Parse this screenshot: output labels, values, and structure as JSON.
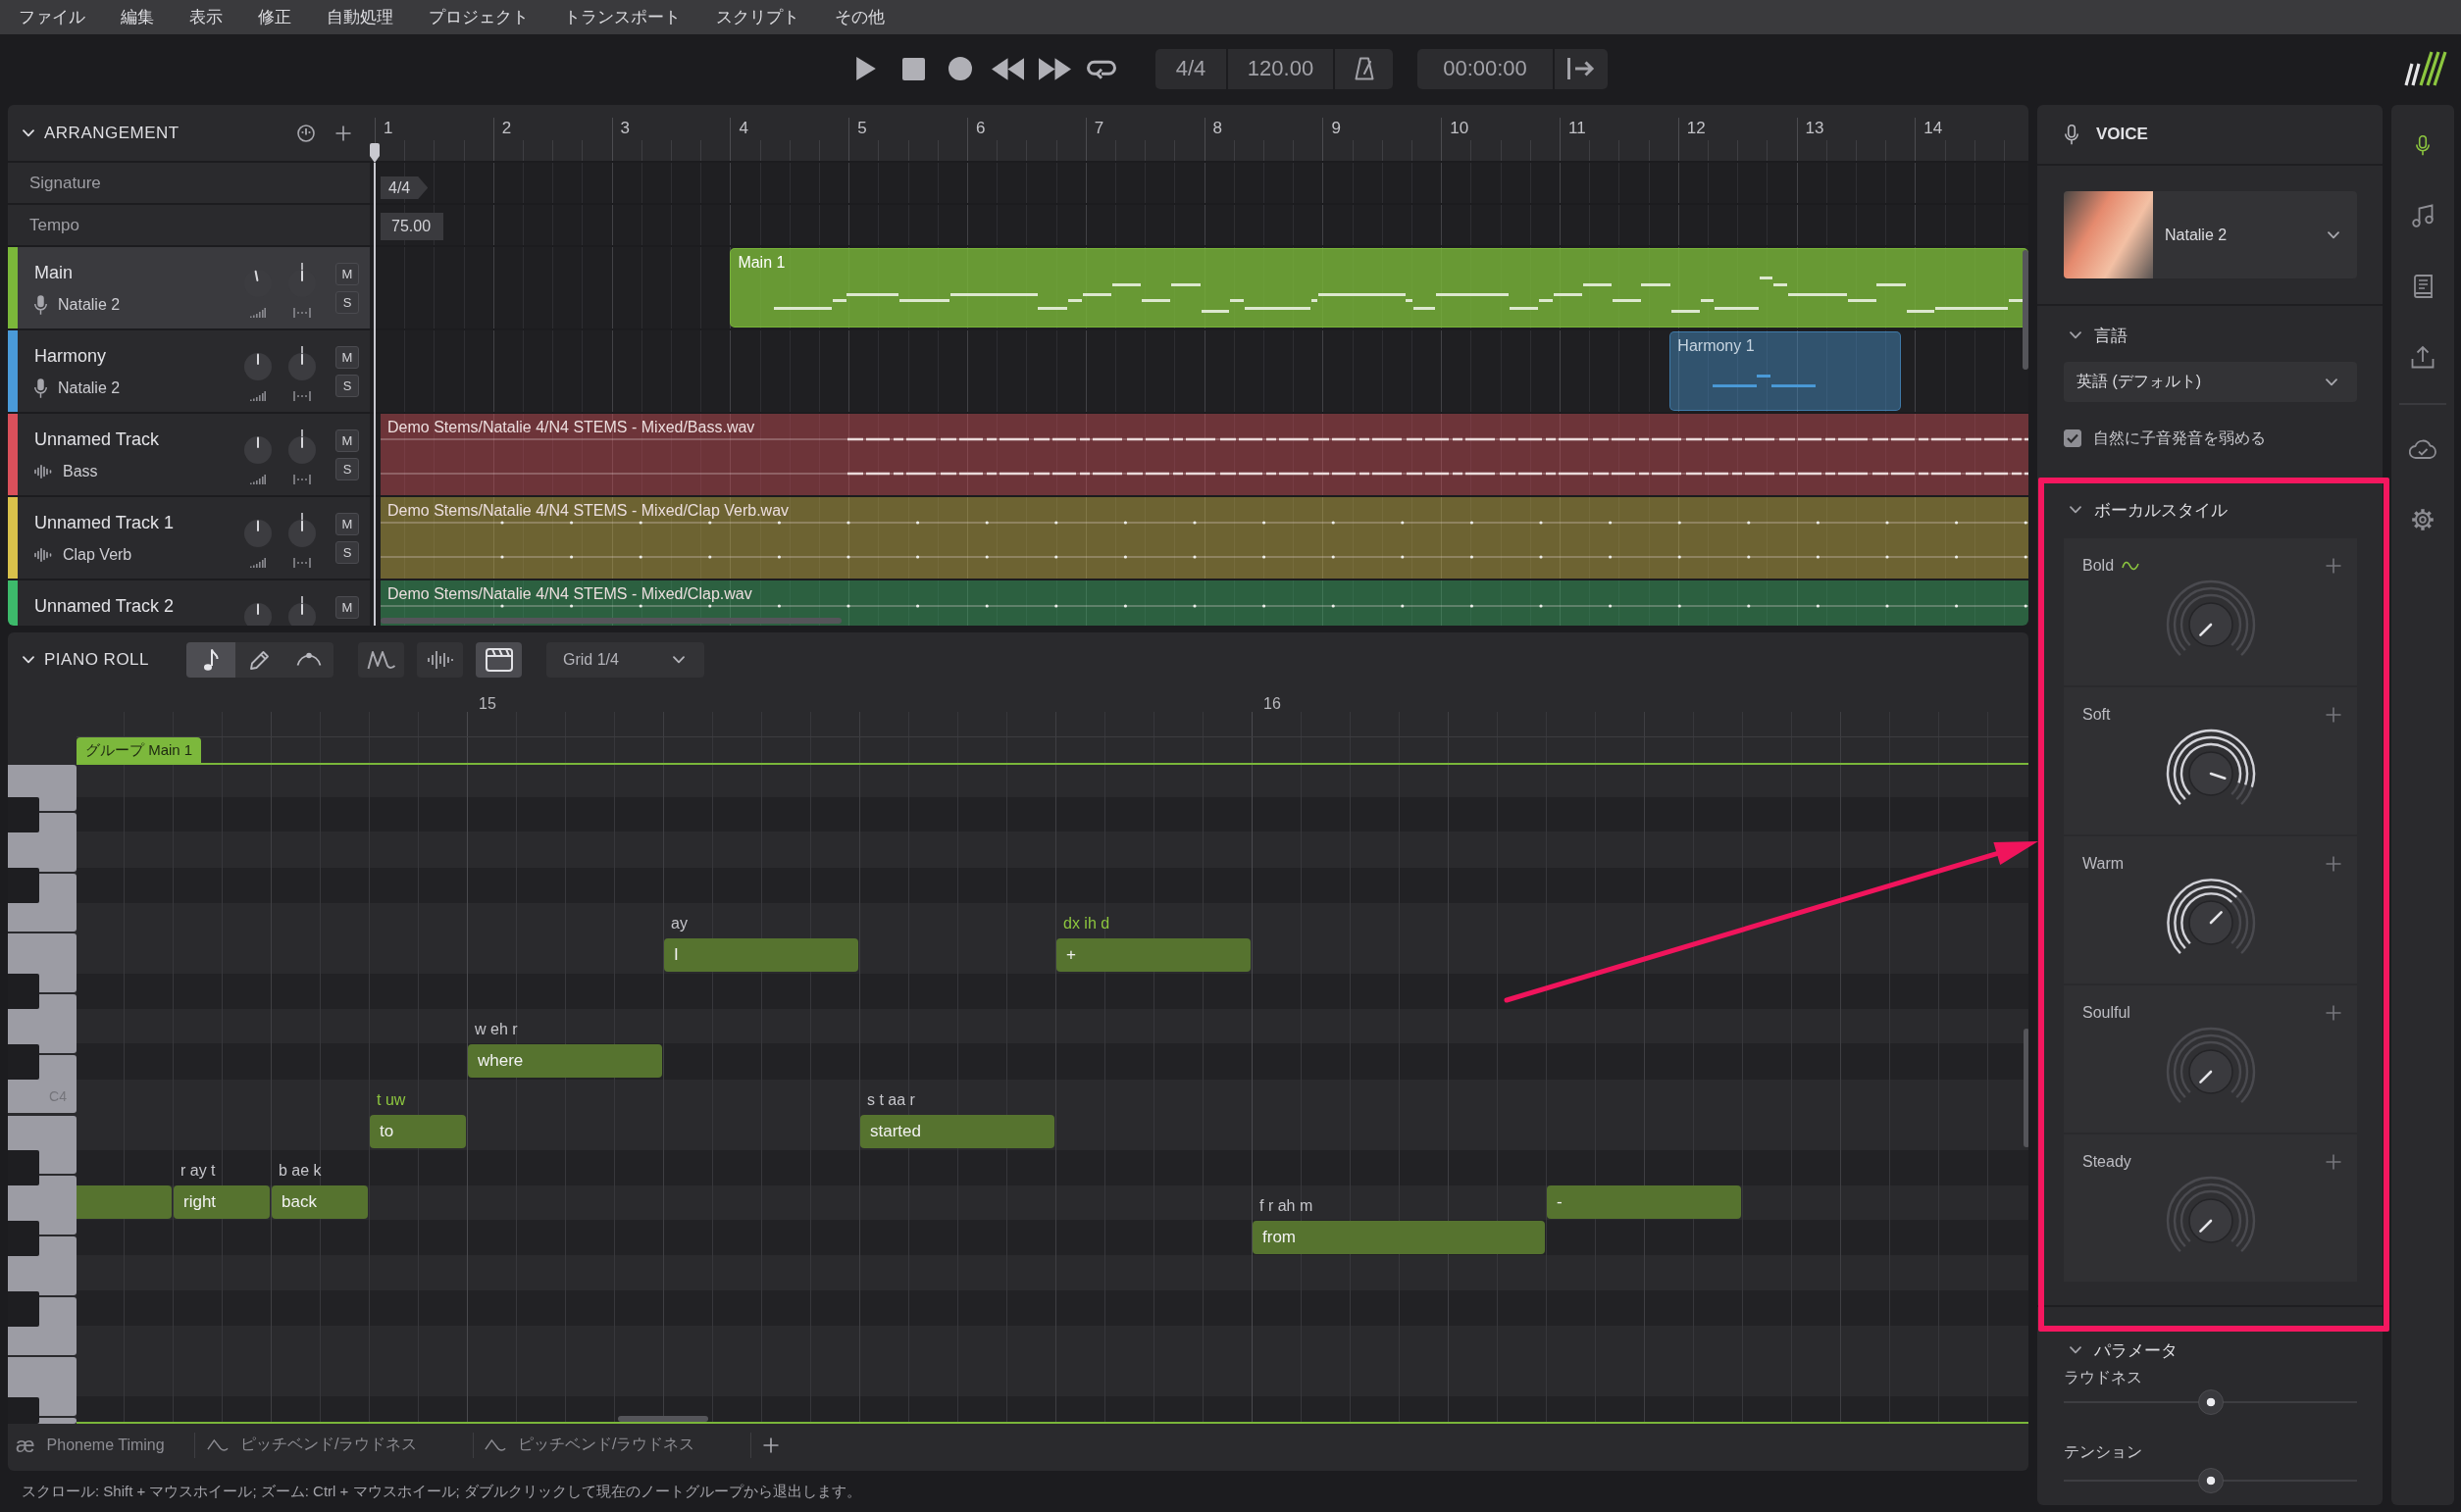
{
  "menu": [
    "ファイル",
    "編集",
    "表示",
    "修正",
    "自動処理",
    "プロジェクト",
    "トランスポート",
    "スクリプト",
    "その他"
  ],
  "transport": {
    "buttons": [
      {
        "kind": "play"
      },
      {
        "kind": "stop"
      },
      {
        "kind": "record"
      },
      {
        "kind": "rewind"
      },
      {
        "kind": "fast_forward"
      },
      {
        "kind": "loop"
      }
    ],
    "signature": "4/4",
    "tempo": "120.00",
    "time": "00:00:00"
  },
  "arrangement": {
    "title": "ARRANGEMENT",
    "ruler": [
      "1",
      "2",
      "3",
      "4",
      "5",
      "6",
      "7",
      "8",
      "9",
      "10",
      "11",
      "12",
      "13",
      "14"
    ],
    "rows": [
      {
        "kind": "signature",
        "label": "Signature",
        "marker": "4/4"
      },
      {
        "kind": "tempo",
        "label": "Tempo",
        "marker": "75.00"
      }
    ],
    "tracks": [
      {
        "name": "Main",
        "source": "Natalie 2",
        "kind": "vocal",
        "color": "#7bb83a",
        "selected": true,
        "volume": {
          "kind": "up_left"
        },
        "pan": {
          "kind": "up"
        },
        "mute": "M",
        "solo": "S",
        "clip": {
          "label": "Main 1"
        }
      },
      {
        "name": "Harmony",
        "source": "Natalie 2",
        "kind": "vocal",
        "color": "#4a9ad8",
        "selected": false,
        "volume": {
          "kind": "up"
        },
        "pan": {
          "kind": "up"
        },
        "mute": "M",
        "solo": "S",
        "clip": {
          "label": "Harmony 1"
        }
      },
      {
        "name": "Unnamed Track",
        "source": "Bass",
        "kind": "audio",
        "color": "#d9505b",
        "selected": false,
        "volume": {
          "kind": "up"
        },
        "pan": {
          "kind": "up"
        },
        "mute": "M",
        "solo": "S",
        "clip": {
          "label": "Demo Stems/Natalie 4/N4 STEMS - Mixed/Bass.wav"
        }
      },
      {
        "name": "Unnamed Track 1",
        "source": "Clap Verb",
        "kind": "audio",
        "color": "#d8c14b",
        "selected": false,
        "volume": {
          "kind": "up"
        },
        "pan": {
          "kind": "up"
        },
        "mute": "M",
        "solo": "S",
        "clip": {
          "label": "Demo Stems/Natalie 4/N4 STEMS - Mixed/Clap Verb.wav"
        }
      },
      {
        "name": "Unnamed Track 2",
        "kind": "audio",
        "color": "#3dba6b",
        "selected": false,
        "volume": {
          "kind": "up"
        },
        "pan": {
          "kind": "up"
        },
        "mute": "M",
        "clip": {
          "label": "Demo Stems/Natalie 4/N4 STEMS - Mixed/Clap.wav"
        }
      }
    ]
  },
  "piano_roll": {
    "title": "PIANO ROLL",
    "tools": [
      {
        "kind": "note",
        "selected": true
      },
      {
        "kind": "pencil",
        "selected": false
      },
      {
        "kind": "curve",
        "selected": false
      }
    ],
    "views": [
      {
        "kind": "vibrato",
        "selected": false
      },
      {
        "kind": "waveform",
        "selected": false
      },
      {
        "kind": "clapperboard",
        "selected": true
      }
    ],
    "grid": "Grid 1/4",
    "ruler": [
      "15",
      "16"
    ],
    "group": "グループ Main 1",
    "key_label": "C4",
    "notes": [
      {
        "cut_off": true
      },
      {
        "lyric": "right",
        "phonemes": "r ay t",
        "phonemes_highlighted": false,
        "cut_off": false
      },
      {
        "lyric": "back",
        "phonemes": "b ae k",
        "phonemes_highlighted": false,
        "cut_off": false
      },
      {
        "lyric": "to",
        "phonemes": "t uw",
        "phonemes_highlighted": true,
        "cut_off": false
      },
      {
        "lyric": "where",
        "phonemes": "w eh r",
        "phonemes_highlighted": false,
        "cut_off": false
      },
      {
        "lyric": "I",
        "phonemes": "ay",
        "phonemes_highlighted": false,
        "cut_off": false
      },
      {
        "lyric": "started",
        "phonemes": "s t aa r",
        "phonemes_highlighted": false,
        "cut_off": false
      },
      {
        "lyric": "+",
        "phonemes": "dx ih d",
        "phonemes_highlighted": true,
        "cut_off": false
      },
      {
        "lyric": "from",
        "phonemes": "f r ah m",
        "phonemes_highlighted": false,
        "cut_off": false
      },
      {
        "lyric": "-",
        "cut_off": false
      }
    ],
    "tabs": [
      {
        "kind": "phoneme",
        "glyph": "æ",
        "label": "Phoneme Timing"
      },
      {
        "kind": "curve",
        "label": "ピッチベンド/ラウドネス"
      },
      {
        "kind": "curve",
        "label": "ピッチベンド/ラウドネス"
      }
    ]
  },
  "status_bar": "スクロール: Shift + マウスホイール; ズーム: Ctrl + マウスホイール; ダブルクリックして現在のノートグループから退出します。",
  "voice_panel": {
    "title": "VOICE",
    "voice": "Natalie 2",
    "language": {
      "title": "言語",
      "value": "英語 (デフォルト)",
      "option": "自然に子音発音を弱める",
      "option_checked": true
    },
    "vocal_style": {
      "title": "ボーカルスタイル",
      "styles": [
        {
          "name": "Bold",
          "kind": "lower_left",
          "automated": true
        },
        {
          "name": "Soft",
          "kind": "right",
          "automated": false
        },
        {
          "name": "Warm",
          "kind": "upper_right",
          "automated": false
        },
        {
          "name": "Soulful",
          "kind": "lower_left",
          "automated": false
        },
        {
          "name": "Steady",
          "kind": "lower_left",
          "automated": false
        }
      ]
    },
    "parameters": {
      "title": "パラメータ",
      "sliders": [
        {
          "name": "ラウドネス",
          "level": 0.5
        },
        {
          "name": "テンション",
          "level": 0.5
        }
      ]
    }
  },
  "sidebar": [
    {
      "kind": "microphone",
      "selected": true
    },
    {
      "kind": "music",
      "selected": false
    },
    {
      "kind": "book",
      "selected": false
    },
    {
      "kind": "upload",
      "selected": false
    },
    {
      "kind": "cloud",
      "selected": false
    },
    {
      "kind": "settings",
      "selected": false
    }
  ]
}
